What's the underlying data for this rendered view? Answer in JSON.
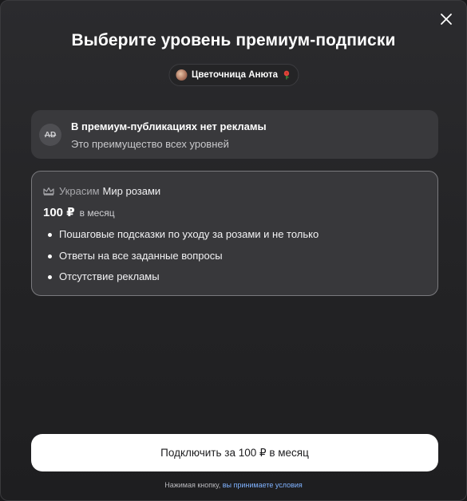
{
  "dialog": {
    "title": "Выберите уровень премиум-подписки",
    "close_icon": "close-icon"
  },
  "author": {
    "name": "Цветочница Анюта",
    "avatar_icon": "avatar",
    "badge_icon": "rose-icon"
  },
  "adfree": {
    "icon": "no-ads-icon",
    "icon_label": "AD",
    "title": "В премиум-публикациях нет рекламы",
    "subtitle": "Это преимущество всех уровней"
  },
  "tier": {
    "icon": "crown-icon",
    "prefix": "Украсим",
    "name": "Мир розами",
    "price": "100 ₽",
    "period": "в месяц",
    "benefits": [
      "Пошаговые подсказки по уходу за розами и не только",
      "Ответы на все заданные вопросы",
      "Отсутствие рекламы"
    ]
  },
  "action": {
    "subscribe_label": "Подключить за 100 ₽ в месяц",
    "terms_prefix": "Нажимая кнопку,",
    "terms_link": "вы принимаете условия"
  },
  "colors": {
    "background": "#232325",
    "card": "#39393c",
    "link": "#7fb2ff",
    "button": "#ffffff"
  }
}
